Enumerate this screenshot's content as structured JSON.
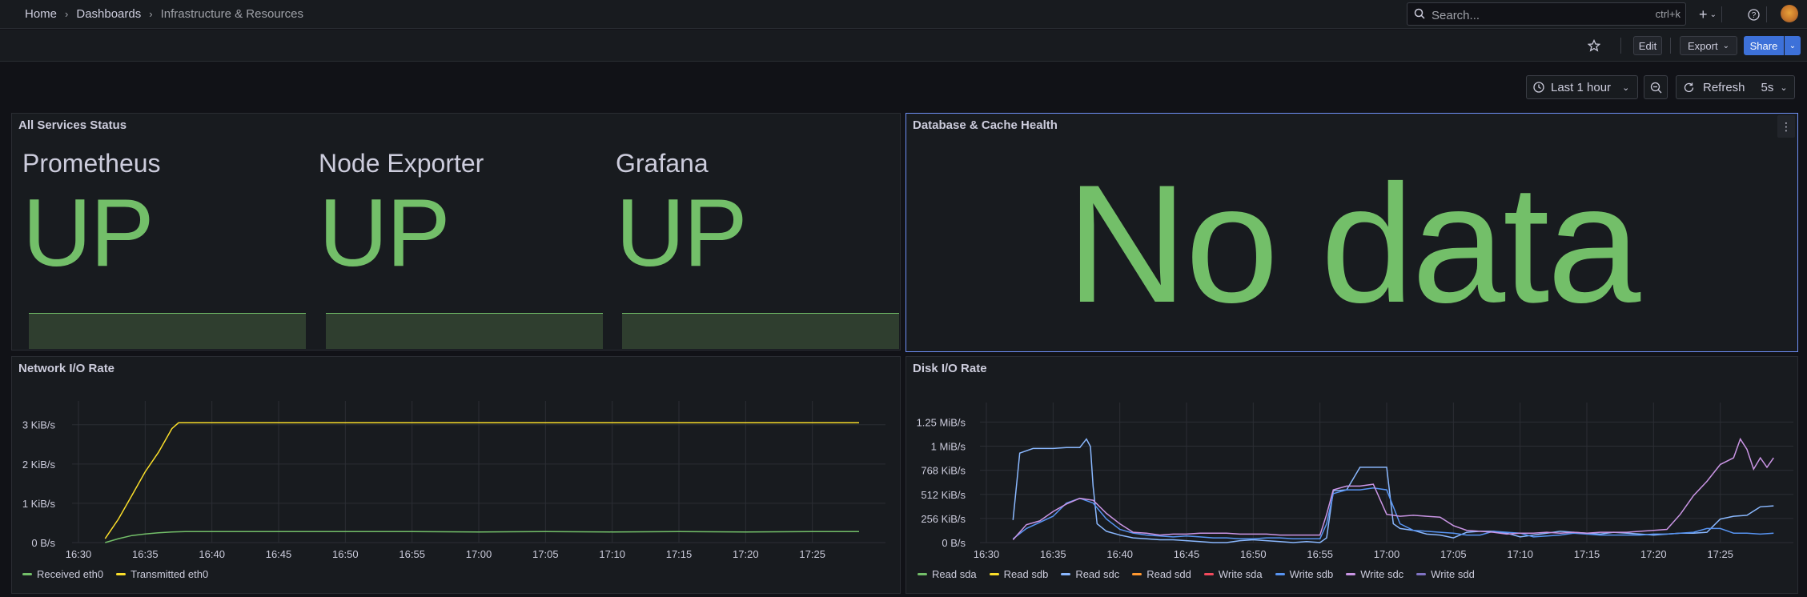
{
  "breadcrumb": {
    "home": "Home",
    "dashboards": "Dashboards",
    "current": "Infrastructure & Resources"
  },
  "search": {
    "placeholder": "Search...",
    "shortcut": "ctrl+k"
  },
  "toolbar": {
    "edit": "Edit",
    "export": "Export",
    "share": "Share"
  },
  "timepicker": {
    "range": "Last 1 hour",
    "refresh": "Refresh",
    "interval": "5s"
  },
  "panels": {
    "services": {
      "title": "All Services Status",
      "stats": [
        {
          "name": "Prometheus",
          "value": "UP"
        },
        {
          "name": "Node Exporter",
          "value": "UP"
        },
        {
          "name": "Grafana",
          "value": "UP"
        }
      ]
    },
    "db": {
      "title": "Database & Cache Health",
      "value": "No data"
    },
    "network": {
      "title": "Network I/O Rate"
    },
    "disk": {
      "title": "Disk I/O Rate"
    }
  },
  "chart_data": [
    {
      "type": "line",
      "title": "Network I/O Rate",
      "x_ticks": [
        "16:30",
        "16:35",
        "16:40",
        "16:45",
        "16:50",
        "16:55",
        "17:00",
        "17:05",
        "17:10",
        "17:15",
        "17:20",
        "17:25"
      ],
      "y_ticks": [
        "0 B/s",
        "1 KiB/s",
        "2 KiB/s",
        "3 KiB/s"
      ],
      "ylim_kib": [
        0,
        3.3
      ],
      "series": [
        {
          "name": "Received eth0",
          "color": "#73bf69",
          "x_min": [
            32,
            33,
            34,
            35,
            36,
            37,
            38,
            40,
            45,
            50,
            55,
            60,
            65,
            70,
            75,
            80,
            85,
            88.5
          ],
          "y_kib": [
            0.0,
            0.1,
            0.18,
            0.22,
            0.25,
            0.27,
            0.28,
            0.28,
            0.28,
            0.28,
            0.28,
            0.27,
            0.28,
            0.27,
            0.28,
            0.27,
            0.28,
            0.28
          ]
        },
        {
          "name": "Transmitted eth0",
          "color": "#fade2a",
          "x_min": [
            32,
            33,
            34,
            35,
            36,
            37,
            37.5,
            40,
            50,
            60,
            70,
            80,
            88.5
          ],
          "y_kib": [
            0.1,
            0.6,
            1.2,
            1.8,
            2.3,
            2.9,
            3.05,
            3.05,
            3.05,
            3.05,
            3.05,
            3.05,
            3.05
          ]
        }
      ]
    },
    {
      "type": "line",
      "title": "Disk I/O Rate",
      "x_ticks": [
        "16:30",
        "16:35",
        "16:40",
        "16:45",
        "16:50",
        "16:55",
        "17:00",
        "17:05",
        "17:10",
        "17:15",
        "17:20",
        "17:25"
      ],
      "y_ticks": [
        "0 B/s",
        "256 KiB/s",
        "512 KiB/s",
        "768 KiB/s",
        "1 MiB/s",
        "1.25 MiB/s"
      ],
      "ylim_kib": [
        0,
        1360
      ],
      "series": [
        {
          "name": "Read sda",
          "color": "#73bf69",
          "x_min": [],
          "y_kib": []
        },
        {
          "name": "Read sdb",
          "color": "#fade2a",
          "x_min": [],
          "y_kib": []
        },
        {
          "name": "Read sdc",
          "color": "#8ab8ff",
          "x_min": [
            32,
            32.5,
            33.5,
            35,
            36,
            37,
            37.5,
            37.8,
            38,
            38.3,
            39,
            40,
            41,
            42,
            43,
            44,
            45,
            46,
            47,
            48,
            49,
            50,
            51,
            52,
            53,
            54,
            55,
            55.5,
            56,
            57,
            58,
            59,
            60,
            60.5,
            61,
            62,
            63,
            64,
            65,
            66,
            67,
            68,
            69,
            70,
            71,
            72,
            73,
            74,
            75,
            76,
            77,
            78,
            79,
            80,
            81,
            82,
            83,
            84,
            85,
            86,
            87,
            88,
            89
          ],
          "y_kib": [
            240,
            950,
            1000,
            1000,
            1010,
            1010,
            1100,
            1020,
            600,
            200,
            120,
            80,
            50,
            40,
            30,
            30,
            20,
            10,
            0,
            0,
            20,
            30,
            20,
            10,
            0,
            10,
            0,
            50,
            550,
            560,
            800,
            800,
            800,
            200,
            150,
            130,
            90,
            80,
            50,
            110,
            120,
            120,
            100,
            60,
            80,
            100,
            120,
            110,
            100,
            90,
            110,
            100,
            90,
            80,
            90,
            100,
            100,
            110,
            250,
            280,
            290,
            380,
            390
          ]
        },
        {
          "name": "Read sdd",
          "color": "#ff9830",
          "x_min": [],
          "y_kib": []
        },
        {
          "name": "Write sda",
          "color": "#f2495c",
          "x_min": [],
          "y_kib": []
        },
        {
          "name": "Write sdb",
          "color": "#5794f2",
          "x_min": [
            32,
            33,
            35,
            36,
            37,
            38,
            39,
            40,
            41,
            42,
            43,
            44,
            45,
            46,
            47,
            48,
            49,
            50,
            51,
            52,
            53,
            54,
            55,
            55.5,
            56,
            57,
            58,
            59,
            60,
            61,
            62,
            63,
            64,
            65,
            66,
            67,
            68,
            69,
            70,
            71,
            72,
            73,
            74,
            75,
            76,
            77,
            78,
            79,
            80,
            81,
            82,
            83,
            84,
            85,
            86,
            87,
            88,
            89
          ],
          "y_kib": [
            40,
            150,
            280,
            420,
            470,
            420,
            250,
            140,
            100,
            80,
            70,
            60,
            70,
            60,
            50,
            50,
            40,
            40,
            50,
            50,
            40,
            40,
            40,
            200,
            520,
            560,
            560,
            580,
            560,
            200,
            130,
            120,
            110,
            100,
            80,
            80,
            120,
            110,
            100,
            60,
            70,
            80,
            100,
            90,
            80,
            80,
            80,
            80,
            90,
            90,
            100,
            110,
            150,
            150,
            100,
            100,
            90,
            100
          ]
        },
        {
          "name": "Write sdc",
          "color": "#ca95e5",
          "x_min": [
            32,
            33,
            34,
            35,
            36,
            37,
            38,
            39,
            40,
            41,
            42,
            43,
            44,
            45,
            46,
            47,
            48,
            49,
            50,
            51,
            52,
            53,
            54,
            55,
            55.5,
            56,
            57,
            58,
            59,
            60,
            61,
            62,
            63,
            64,
            65,
            66,
            67,
            68,
            69,
            70,
            71,
            72,
            73,
            74,
            75,
            76,
            77,
            78,
            79,
            80,
            81,
            82,
            83,
            84,
            85,
            86,
            86.5,
            87,
            87.5,
            88,
            88.5,
            89
          ],
          "y_kib": [
            30,
            190,
            230,
            330,
            410,
            470,
            450,
            310,
            200,
            110,
            100,
            80,
            90,
            90,
            100,
            100,
            100,
            90,
            90,
            90,
            80,
            80,
            80,
            80,
            300,
            560,
            600,
            600,
            620,
            300,
            280,
            290,
            280,
            270,
            180,
            130,
            120,
            110,
            90,
            100,
            100,
            110,
            100,
            110,
            100,
            110,
            110,
            110,
            120,
            130,
            140,
            300,
            500,
            650,
            830,
            900,
            1100,
            990,
            780,
            900,
            800,
            900
          ]
        },
        {
          "name": "Write sdd",
          "color": "#8073c4",
          "x_min": [],
          "y_kib": []
        }
      ]
    }
  ]
}
